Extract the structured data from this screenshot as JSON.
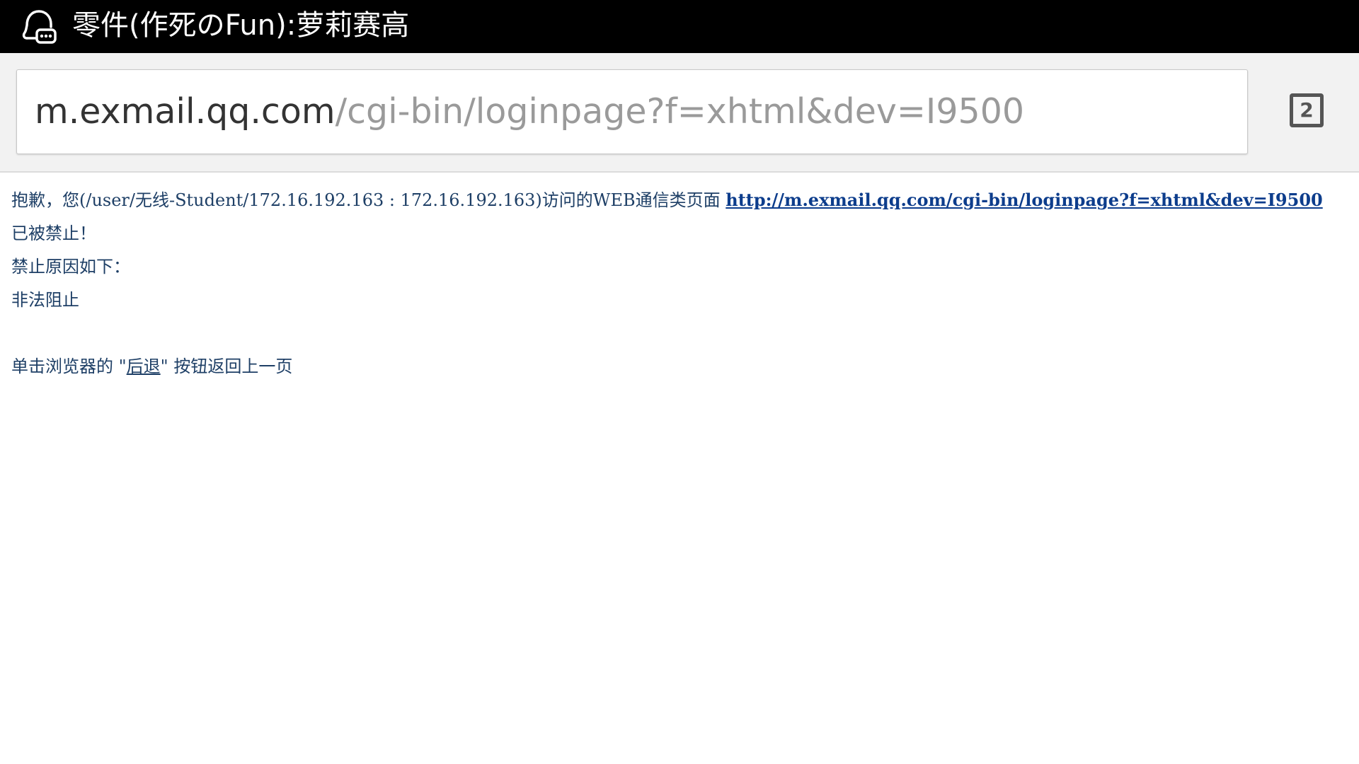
{
  "title_bar": {
    "title": "零件(作死のFun):萝莉赛高",
    "icon": "qq-chat-icon"
  },
  "address_bar": {
    "host": "m.exmail.qq.com",
    "path": "/cgi-bin/loginpage?f=xhtml&dev=I9500",
    "tab_count": "2"
  },
  "page": {
    "message_prefix": "抱歉，您(/user/无线-Student/172.16.192.163 : 172.16.192.163)访问的WEB通信类页面 ",
    "blocked_url": "http://m.exmail.qq.com/cgi-bin/loginpage?f=xhtml&dev=I9500",
    "message_suffix": " 已被禁止！",
    "reason_heading": "禁止原因如下：",
    "reason": "非法阻止",
    "back_prefix": "单击浏览器的 \"",
    "back_link": "后退",
    "back_suffix": "\" 按钮返回上一页"
  }
}
